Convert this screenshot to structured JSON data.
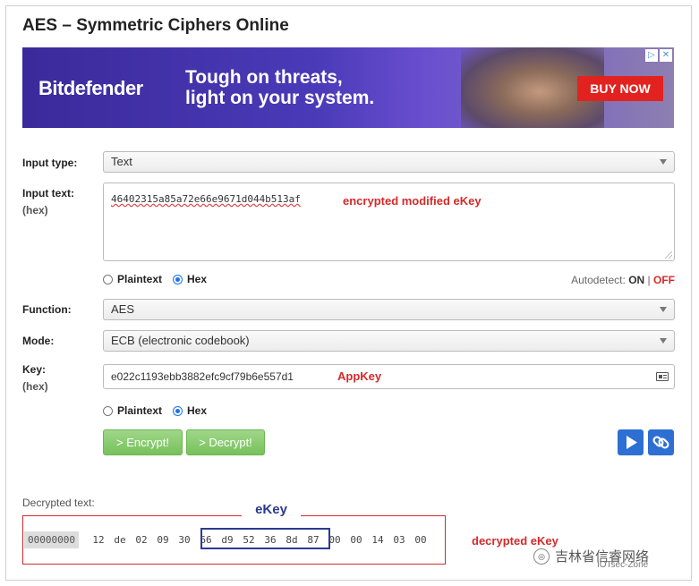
{
  "page": {
    "title": "AES – Symmetric Ciphers Online"
  },
  "ad": {
    "brand": "Bitdefender",
    "tagline_line1": "Tough on threats,",
    "tagline_line2": "light on your system.",
    "cta": "BUY NOW",
    "info_glyph": "▷",
    "close_glyph": "✕"
  },
  "form": {
    "input_type": {
      "label": "Input type:",
      "value": "Text"
    },
    "input_text": {
      "label": "Input text:",
      "sublabel": "(hex)",
      "value": "46402315a85a72e66e9671d044b513af",
      "annotation": "encrypted modified eKey"
    },
    "input_format": {
      "options": [
        "Plaintext",
        "Hex"
      ],
      "selected": "Hex",
      "autodetect_label": "Autodetect:",
      "autodetect_on": "ON",
      "separator": "|",
      "autodetect_off": "OFF"
    },
    "function": {
      "label": "Function:",
      "value": "AES"
    },
    "mode": {
      "label": "Mode:",
      "value": "ECB (electronic codebook)"
    },
    "key": {
      "label": "Key:",
      "sublabel": "(hex)",
      "value": "e022c1193ebb3882efc9cf79b6e557d1",
      "annotation": "AppKey"
    },
    "key_format": {
      "options": [
        "Plaintext",
        "Hex"
      ],
      "selected": "Hex"
    },
    "buttons": {
      "encrypt": "> Encrypt!",
      "decrypt": "> Decrypt!"
    }
  },
  "output": {
    "label": "Decrypted text:",
    "address": "00000000",
    "bytes": [
      "12",
      "de",
      "02",
      "09",
      "30",
      "66",
      "d9",
      "52",
      "36",
      "8d",
      "87",
      "00",
      "00",
      "14",
      "03",
      "00"
    ],
    "highlight_label": "eKey",
    "annotation": "decrypted eKey"
  },
  "watermark": {
    "text": "吉林省信睿网络",
    "sub": "IOTsec-Zone"
  },
  "colors": {
    "annotation_red": "#d42a2a",
    "highlight_blue": "#2b3a8f",
    "button_green": "#77c15c",
    "icon_blue": "#2d6fd2"
  }
}
